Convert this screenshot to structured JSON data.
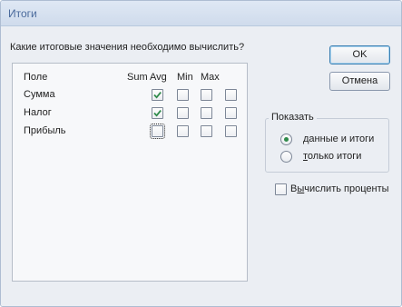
{
  "window": {
    "title": "Итоги"
  },
  "question": "Какие итоговые значения необходимо вычислить?",
  "table": {
    "headers": {
      "field": "Поле",
      "sum": "Sum",
      "avg": "Avg",
      "min": "Min",
      "max": "Max"
    },
    "rows": [
      {
        "label": "Сумма",
        "sum": true,
        "avg": false,
        "min": false,
        "max": false
      },
      {
        "label": "Налог",
        "sum": true,
        "avg": false,
        "min": false,
        "max": false
      },
      {
        "label": "Прибыль",
        "sum": false,
        "avg": false,
        "min": false,
        "max": false
      }
    ]
  },
  "buttons": {
    "ok": "OK",
    "cancel": "Отмена"
  },
  "show_group": {
    "legend": "Показать",
    "options": [
      {
        "hotkey": "д",
        "rest": "анные и итоги",
        "selected": true
      },
      {
        "hotkey": "т",
        "rest": "олько итоги",
        "selected": false
      }
    ]
  },
  "percent_checkbox": {
    "before": "В",
    "hotkey": "ы",
    "rest": "числить проценты",
    "checked": false
  },
  "colors": {
    "check": "#2f8a4a",
    "title_text": "#4a6a9c",
    "default_button_border": "#3c7fb1"
  }
}
